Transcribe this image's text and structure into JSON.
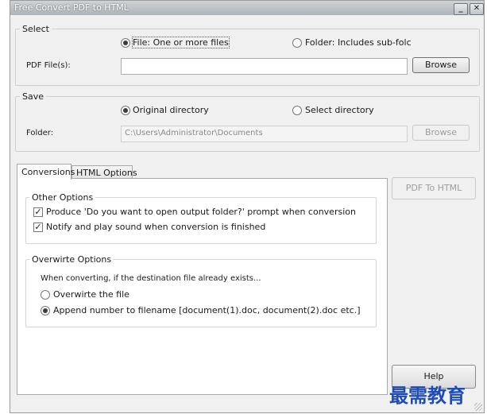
{
  "window": {
    "title": "Free Convert PDF to HTML"
  },
  "select": {
    "legend": "Select",
    "radio_file": "File:  One or more files",
    "radio_folder": "Folder: Includes sub-folc",
    "pdf_files_label": "PDF File(s):",
    "pdf_files_value": "",
    "browse": "Browse"
  },
  "save": {
    "legend": "Save",
    "radio_original": "Original directory",
    "radio_select": "Select directory",
    "folder_label": "Folder:",
    "folder_value": "C:\\Users\\Administrator\\Documents",
    "browse": "Browse"
  },
  "tabs": [
    {
      "label": "Conversions",
      "active": true
    },
    {
      "label": "HTML Options",
      "active": false
    }
  ],
  "other_options": {
    "title": "Other Options",
    "option1": "Produce 'Do you want to open output folder?' prompt when conversion is finis",
    "option1_checked": true,
    "option2": "Notify and play sound when conversion is finished",
    "option2_checked": true
  },
  "overwrite_options": {
    "title": "Overwirte Options",
    "intro": "When converting, if the destination file already exists...",
    "option1": "Overwirte the file",
    "option2": "Append number to filename  [document(1).doc, document(2).doc etc.]",
    "selected": "append"
  },
  "buttons": {
    "convert": "PDF To HTML",
    "help": "Help"
  },
  "watermark": "最需教育"
}
